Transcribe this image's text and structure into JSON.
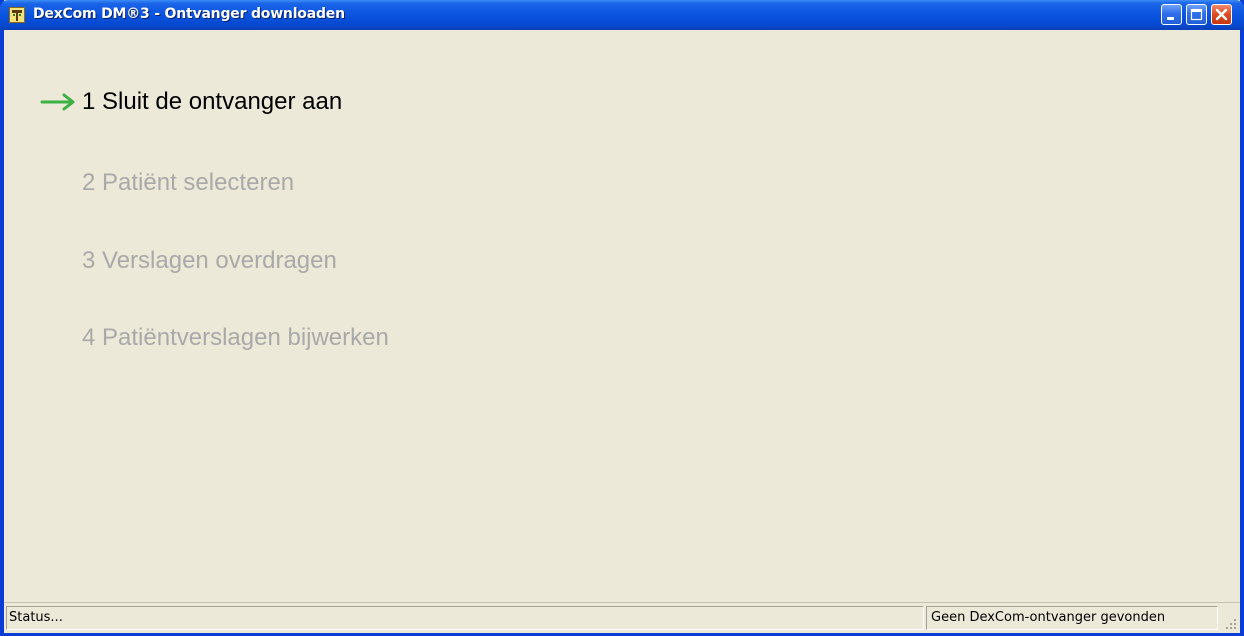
{
  "window": {
    "title": "DexCom DM®3 - Ontvanger downloaden",
    "app_icon": "dexcom-app-icon",
    "controls": {
      "minimize_icon": "minimize-icon",
      "maximize_icon": "maximize-icon",
      "close_icon": "close-icon"
    },
    "frame_color": "#0A3CD6",
    "close_color": "#DD4A22"
  },
  "wizard": {
    "current_step_icon": "green-arrow-icon",
    "accent_color": "#3CB043",
    "active_color": "#000000",
    "inactive_color": "#A9A9A9",
    "steps": [
      {
        "label": "1 Sluit de ontvanger aan",
        "state": "active"
      },
      {
        "label": "2 Patiënt selecteren",
        "state": "inactive"
      },
      {
        "label": "3 Verslagen overdragen",
        "state": "inactive"
      },
      {
        "label": "4 Patiëntverslagen bijwerken",
        "state": "inactive"
      }
    ]
  },
  "statusbar": {
    "status_text": "Status...",
    "device_status": "Geen DexCom-ontvanger gevonden",
    "grip_icon": "resize-grip-icon"
  }
}
